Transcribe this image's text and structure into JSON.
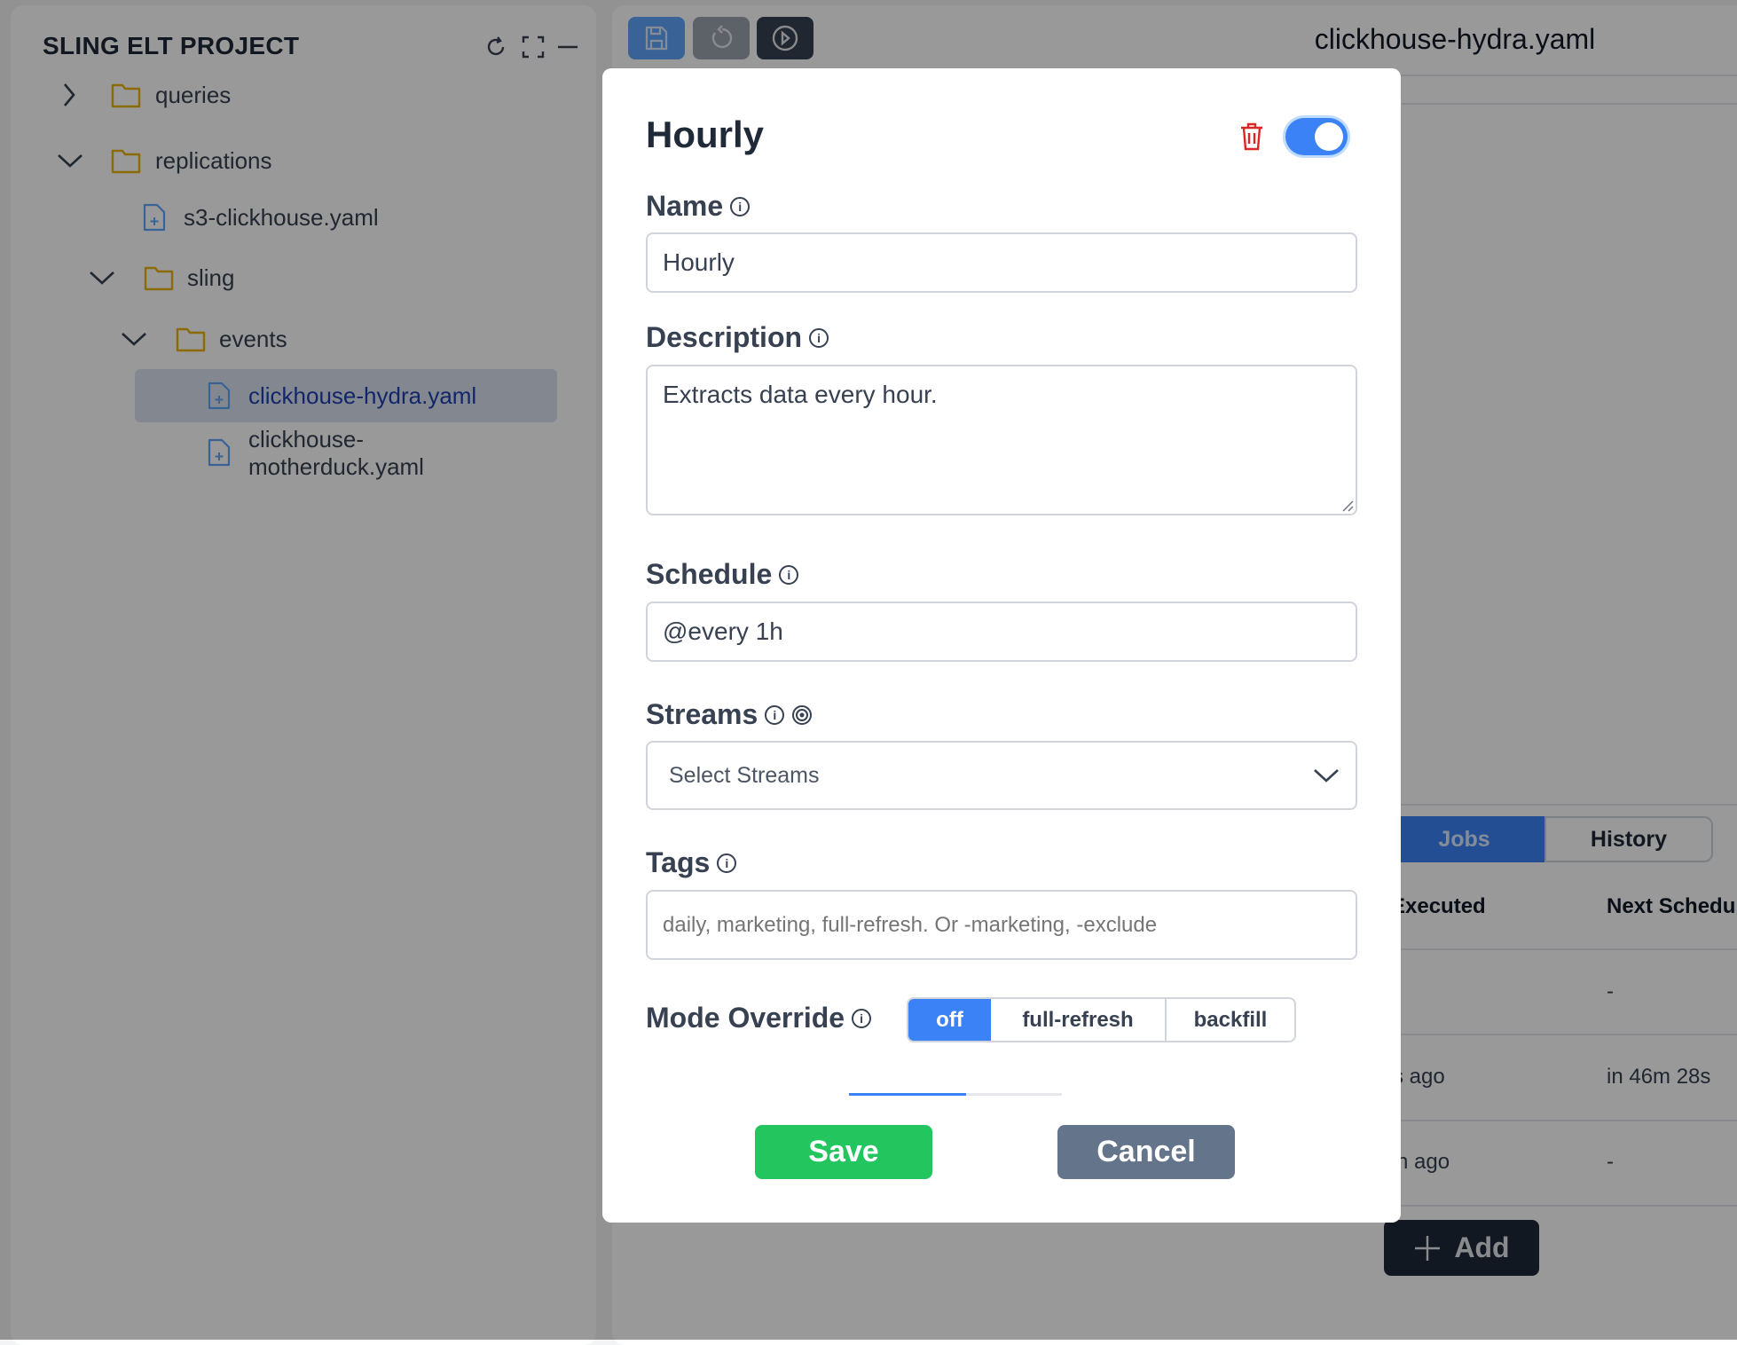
{
  "sidebar": {
    "title": "SLING ELT PROJECT",
    "icons": [
      "refresh-icon",
      "fullscreen-icon",
      "minimize-icon"
    ],
    "tree": [
      {
        "label": "queries",
        "type": "folder",
        "expanded": false
      },
      {
        "label": "replications",
        "type": "folder",
        "expanded": true
      },
      {
        "label": "s3-clickhouse.yaml",
        "type": "file"
      },
      {
        "label": "sling",
        "type": "folder",
        "expanded": true
      },
      {
        "label": "events",
        "type": "folder",
        "expanded": true
      },
      {
        "label": "clickhouse-hydra.yaml",
        "type": "file",
        "selected": true
      },
      {
        "label_line1": "clickhouse-",
        "label_line2": "motherduck.yaml",
        "type": "file"
      }
    ]
  },
  "toolbar": {
    "icons": [
      "save-icon",
      "undo-icon",
      "play-icon"
    ],
    "file_title": "clickhouse-hydra.yaml"
  },
  "jobs_panel": {
    "tabs": [
      {
        "label": "Jobs",
        "active": true
      },
      {
        "label": "History",
        "active": false
      }
    ],
    "headers": [
      "Executed",
      "Next Schedu"
    ],
    "rows": [
      [
        "",
        "-"
      ],
      [
        "s ago",
        "in 46m 28s"
      ],
      [
        "h ago",
        "-"
      ]
    ],
    "add_label": "Add"
  },
  "modal": {
    "title": "Hourly",
    "enabled": true,
    "name": {
      "label": "Name",
      "value": "Hourly"
    },
    "description": {
      "label": "Description",
      "value": "Extracts data every hour."
    },
    "schedule": {
      "label": "Schedule",
      "value": "@every 1h"
    },
    "streams": {
      "label": "Streams",
      "placeholder": "Select Streams"
    },
    "tags": {
      "label": "Tags",
      "placeholder": "daily, marketing, full-refresh. Or -marketing, -exclude"
    },
    "mode_override": {
      "label": "Mode Override",
      "options": [
        "off",
        "full-refresh",
        "backfill"
      ],
      "selected": "off"
    },
    "save_label": "Save",
    "cancel_label": "Cancel"
  },
  "colors": {
    "primary": "#3b82f6",
    "save": "#22c55e",
    "cancel": "#64748b",
    "danger": "#dc2626",
    "folder": "#eab308",
    "selected_text": "#1e40af"
  }
}
